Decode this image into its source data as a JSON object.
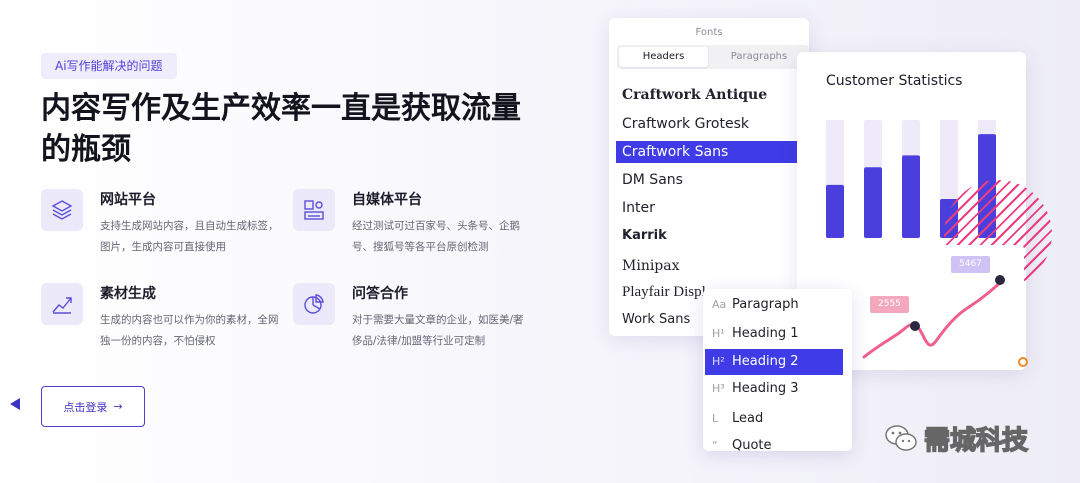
{
  "badge": "Ai写作能解决的问题",
  "headline": "内容写作及生产效率一直是获取流量的瓶颈",
  "features": [
    {
      "icon": "layers-icon",
      "title": "网站平台",
      "desc": "支持生成网站内容，且自动生成标签，图片，生成内容可直接使用"
    },
    {
      "icon": "media-icon",
      "title": "自媒体平台",
      "desc": "经过测试可过百家号、头条号、企鹅号、搜狐号等各平台原创检测"
    },
    {
      "icon": "growth-chart-icon",
      "title": "素材生成",
      "desc": "生成的内容也可以作为你的素材，全网独一份的内容，不怕侵权"
    },
    {
      "icon": "pie-chart-icon",
      "title": "问答合作",
      "desc": "对于需要大量文章的企业，如医美/奢侈品/法律/加盟等行业可定制"
    }
  ],
  "login_button": {
    "label": "点击登录",
    "arrow": "→"
  },
  "fonts_panel": {
    "title": "Fonts",
    "tabs": [
      "Headers",
      "Paragraphs"
    ],
    "fonts": [
      "Craftwork Antique",
      "Craftwork Grotesk",
      "Craftwork Sans",
      "DM Sans",
      "Inter",
      "Karrik",
      "Minipax",
      "Playfair Display",
      "Work Sans"
    ],
    "selected_font": "Craftwork Sans"
  },
  "chart_panel": {
    "title": "Customer Statistics",
    "bars": [
      0.45,
      0.6,
      0.7,
      0.33,
      0.88
    ],
    "colors": {
      "bar": "#4a3fdd",
      "track": "#eeeaf9",
      "hatch": "#ec3d7f"
    }
  },
  "line_card": {
    "tags": [
      "2555",
      "5467"
    ],
    "colors": {
      "line": "#ef5f8f",
      "dot": "#2a2840"
    }
  },
  "paragraph_menu": {
    "items": [
      {
        "icon": "Aa",
        "label": "Paragraph"
      },
      {
        "icon": "H¹",
        "label": "Heading 1"
      },
      {
        "icon": "H²",
        "label": "Heading 2"
      },
      {
        "icon": "H³",
        "label": "Heading 3"
      },
      {
        "icon": "L",
        "label": "Lead"
      },
      {
        "icon": "“",
        "label": "Quote"
      }
    ],
    "selected": "Heading 2"
  },
  "watermark": "需城科技"
}
